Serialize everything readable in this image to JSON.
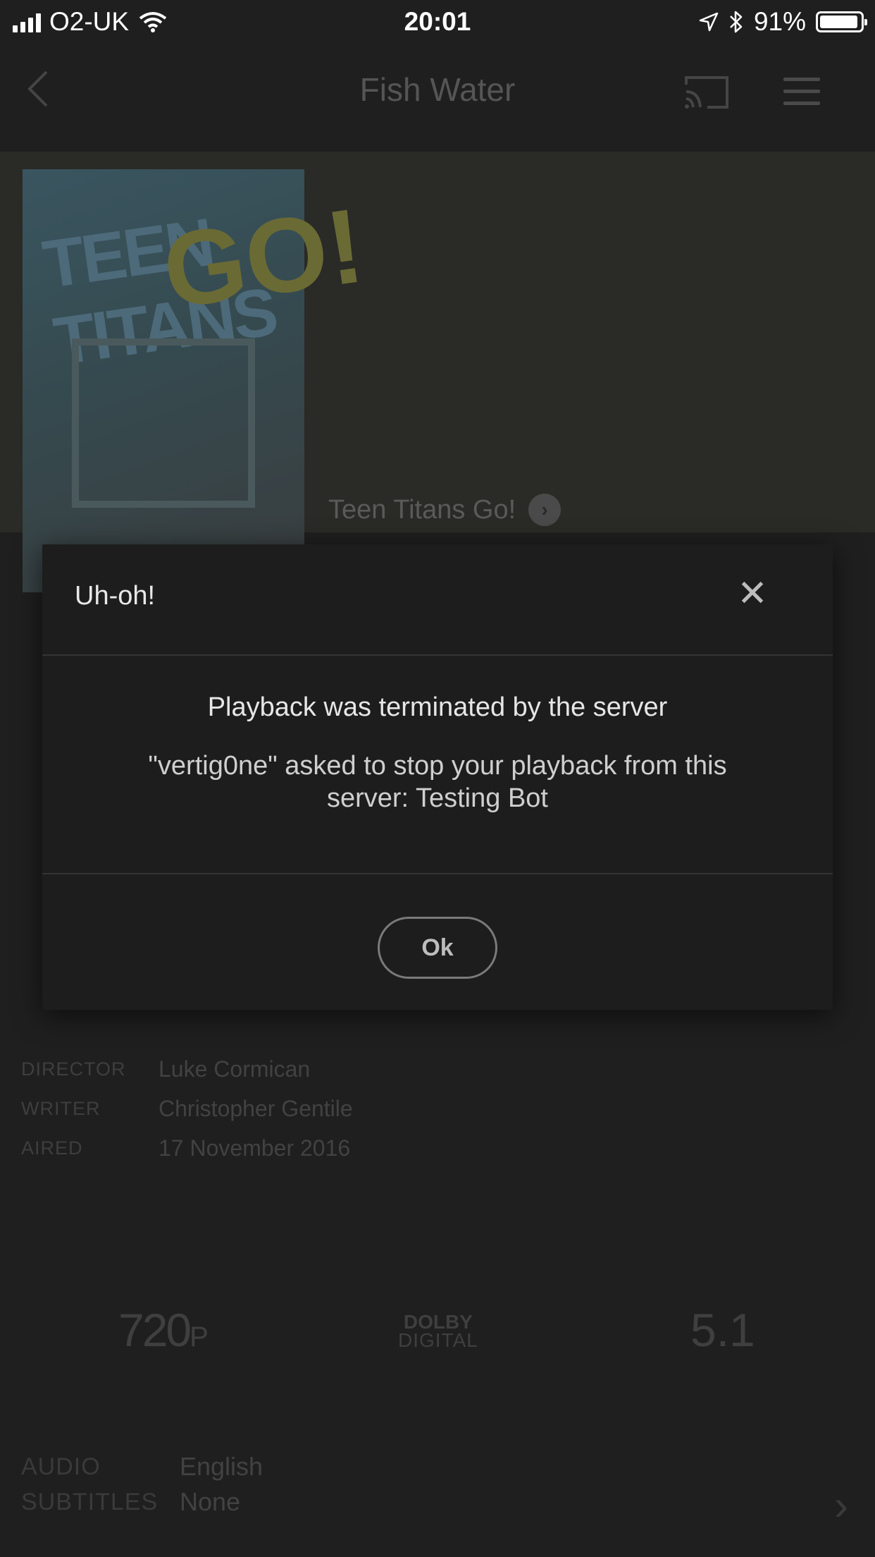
{
  "status_bar": {
    "carrier": "O2-UK",
    "time": "20:01",
    "battery": "91%",
    "battery_level": 0.91,
    "icons": [
      "signal-icon",
      "wifi-icon",
      "location-icon",
      "bluetooth-icon",
      "battery-icon"
    ]
  },
  "nav": {
    "title": "Fish Water",
    "icons": [
      "back-icon",
      "cast-icon",
      "menu-icon"
    ]
  },
  "show": {
    "series_link": "Teen Titans Go!",
    "poster_text": [
      "TEEN TITANS",
      "GO!"
    ]
  },
  "details": [
    {
      "label": "DIRECTOR",
      "value": "Luke Cormican"
    },
    {
      "label": "WRITER",
      "value": "Christopher Gentile"
    },
    {
      "label": "AIRED",
      "value": "17 November 2016"
    }
  ],
  "badges": {
    "resolution": "720",
    "resolution_suffix": "P",
    "dolby_top": "DOLBY",
    "dolby_bottom": "DIGITAL",
    "channels": "5.1"
  },
  "tracks": [
    {
      "label": "AUDIO",
      "value": "English"
    },
    {
      "label": "SUBTITLES",
      "value": "None"
    }
  ],
  "dialog": {
    "title": "Uh-oh!",
    "close_symbol": "✕",
    "heading": "Playback was terminated by the server",
    "message": "\"vertig0ne\" asked to stop your playback from this server: Testing Bot",
    "ok_label": "Ok"
  },
  "colors": {
    "background": "#1f1f1f",
    "modal": "#1d1d1d",
    "divider": "#333333"
  }
}
